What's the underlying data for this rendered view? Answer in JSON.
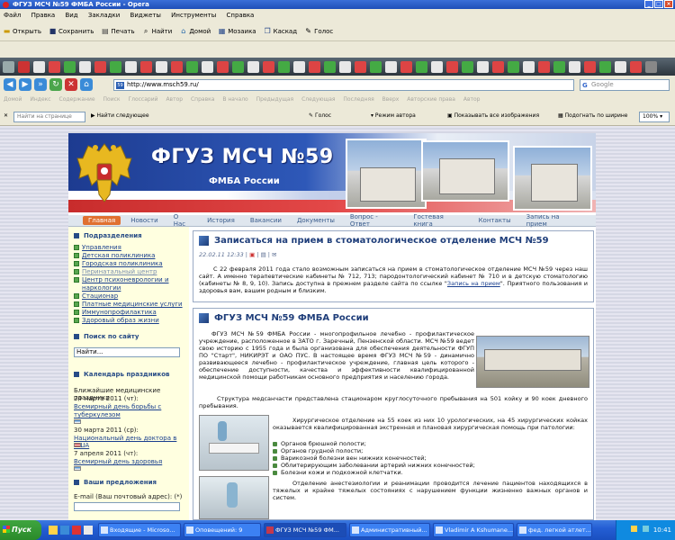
{
  "window": {
    "title": "ФГУЗ МСЧ №59 ФМБА России - Opera"
  },
  "menu": [
    "Файл",
    "Правка",
    "Вид",
    "Закладки",
    "Виджеты",
    "Инструменты",
    "Справка"
  ],
  "toolbar": {
    "open": "Открыть",
    "save": "Сохранить",
    "print": "Печать",
    "find": "Найти",
    "home": "Домой",
    "mosaic": "Мозаика",
    "cascade": "Каскад",
    "voice": "Голос"
  },
  "address": {
    "url": "http://www.msch59.ru/",
    "search_placeholder": "Google"
  },
  "personal_bar": [
    "Домой",
    "Индекс",
    "Содержание",
    "Поиск",
    "Глоссарий",
    "Автор",
    "Справка",
    "В начало",
    "Предыдущая",
    "Следующая",
    "Последняя",
    "Вверх",
    "Авторские права",
    "Автор"
  ],
  "findbar": {
    "placeholder": "Найти на странице",
    "find_next": "Найти следующее",
    "voice": "Голос",
    "author_mode": "Режим автора",
    "show_images": "Показывать все изображения",
    "fit_width": "Подогнать по ширине",
    "zoom": "100%"
  },
  "site": {
    "banner_title": "ФГУЗ МСЧ №59",
    "banner_subtitle": "ФМБА России",
    "nav": [
      "Главная",
      "Новости",
      "О Нас",
      "История",
      "Вакансии",
      "Документы",
      "Вопрос - Ответ",
      "Гостевая книга",
      "Контакты",
      "Запись на прием"
    ],
    "sidebar": {
      "divisions_title": "Подразделения",
      "divisions": [
        "Управления",
        "Детская поликлиника",
        "Городская поликлиника",
        "Перинатальный центр",
        "Центр психоневрологии и",
        "наркологии",
        "Стационар",
        "Платные медицинские услуги",
        "Иммунопрофилактика",
        "Здоровый образ жизни"
      ],
      "search_title": "Поиск по сайту",
      "search_value": "Найти...",
      "calendar_title": "Календарь праздников",
      "calendar_intro": "Ближайшие медицинские праздники",
      "events": [
        {
          "date": "24 марта 2011 (чт):",
          "lines": [
            "Всемирный день борьбы с",
            "туберкулезом"
          ]
        },
        {
          "date": "30 марта 2011 (ср):",
          "lines": [
            "Национальный день доктора в США"
          ]
        },
        {
          "date": "7 апреля 2011 (чт):",
          "lines": [
            "Всемирный день здоровья"
          ]
        }
      ],
      "offers_title": "Ваши предложения",
      "email_label": "E-mail (Ваш почтовый адрес): (*)"
    },
    "article1": {
      "title": "Записаться на прием в стоматологическое отделение МСЧ №59",
      "meta": "22.02.11 12:33 |",
      "text_before_link": "С 22 февраля 2011 года стало возможным записаться на прием в стоматологическое отделение МСЧ №59 через наш сайт. А именно терапевтические кабинеты № 712, 713; пародонтологический кабинет № 710 и в детскую стоматологию (кабинеты № 8, 9, 10). Запись доступна в прежнем разделе сайта по ссылке \"",
      "link": "Запись на прием",
      "text_after_link": "\". Приятного пользования и здоровья вам, вашим родным и близким."
    },
    "article2": {
      "title": "ФГУЗ МСЧ №59 ФМБА России",
      "p1": "ФГУЗ МСЧ №59 ФМБА России - многопрофильное лечебно - профилактическое учреждение, расположенное в ЗАТО г. Заречный, Пензенской области. МСЧ №59 ведет свою историю с 1955 года и была организована для обеспечения деятельности ФГУП ПО \"Старт\", НИКИРЭТ и ОАО ПУС. В настоящее время ФГУЗ МСЧ №59 - динамично развивающееся лечебно - профилактическое учреждение, главная цель которого - обеспечение доступности, качества и эффективности квалифицированной медицинской помощи работникам основного предприятия и населению города.",
      "p2": "Структура медсанчасти представлена стационаром круглосуточного пребывания на 501 койку и 90 коек дневного пребывания.",
      "p3": "Хирургическое отделение на 55 коек из них 10 урологических, на 45 хирургических койках оказывается квалифицированная экстренная и плановая хирургическая помощь при патологии:",
      "list": [
        "Органов брюшной полости;",
        "Органов грудной полости;",
        "Варикозной болезни вен нижних конечностей;",
        "Облитерирующим заболевании артерий нижних конечностей;",
        "Болезни кожи и подкожной клетчатки."
      ],
      "p4": "Отделение анестезиологии и реанимации проводится лечение пациентов находящихся в тяжелых и крайне тяжелых состояниях с нарушением функции жизненно важных органов и систем."
    }
  },
  "taskbar": {
    "start": "Пуск",
    "tasks": [
      "Входящие - Microso...",
      "Оповещений: 9",
      "ФГУЗ МСЧ №59 ФМ...",
      "Административный...",
      "Vladimir A Kshumane...",
      "фед. легкой атлет..."
    ],
    "clock": "10:41"
  }
}
